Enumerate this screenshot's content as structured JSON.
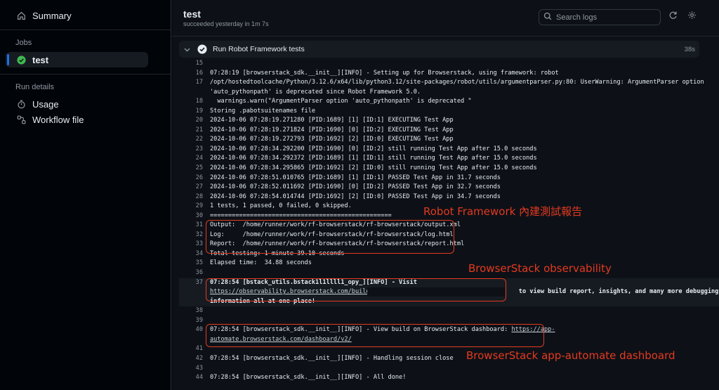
{
  "sidebar": {
    "summary": {
      "label": "Summary",
      "icon": "home-icon"
    },
    "jobs_heading": "Jobs",
    "jobs": [
      {
        "label": "test",
        "icon": "check-circle-icon"
      }
    ],
    "run_details_heading": "Run details",
    "details": [
      {
        "label": "Usage",
        "icon": "stopwatch-icon"
      },
      {
        "label": "Workflow file",
        "icon": "workflow-icon"
      }
    ]
  },
  "header": {
    "title": "test",
    "subtitle": "succeeded yesterday in 1m 7s",
    "search_placeholder": "Search logs"
  },
  "step": {
    "name": "Run Robot Framework tests",
    "duration": "38s"
  },
  "log_lines": [
    {
      "n": "15",
      "t": ""
    },
    {
      "n": "16",
      "t": "07:28:19 [browserstack_sdk.__init__][INFO] - Setting up for Browserstack, using framework: robot"
    },
    {
      "n": "17",
      "t": "/opt/hostedtoolcache/Python/3.12.6/x64/lib/python3.12/site-packages/robot/utils/argumentparser.py:80: UserWarning: ArgumentParser option"
    },
    {
      "n": "",
      "t": "'auto_pythonpath' is deprecated since Robot Framework 5.0."
    },
    {
      "n": "18",
      "t": "  warnings.warn(\"ArgumentParser option 'auto_pythonpath' is deprecated \""
    },
    {
      "n": "19",
      "t": "Storing .pabotsuitenames file"
    },
    {
      "n": "20",
      "t": "2024-10-06 07:28:19.271280 [PID:1689] [1] [ID:1] EXECUTING Test App"
    },
    {
      "n": "21",
      "t": "2024-10-06 07:28:19.271824 [PID:1690] [0] [ID:2] EXECUTING Test App"
    },
    {
      "n": "22",
      "t": "2024-10-06 07:28:19.272793 [PID:1692] [2] [ID:0] EXECUTING Test App"
    },
    {
      "n": "23",
      "t": "2024-10-06 07:28:34.292200 [PID:1690] [0] [ID:2] still running Test App after 15.0 seconds"
    },
    {
      "n": "24",
      "t": "2024-10-06 07:28:34.292372 [PID:1689] [1] [ID:1] still running Test App after 15.0 seconds"
    },
    {
      "n": "25",
      "t": "2024-10-06 07:28:34.295865 [PID:1692] [2] [ID:0] still running Test App after 15.0 seconds"
    },
    {
      "n": "26",
      "t": "2024-10-06 07:28:51.010765 [PID:1689] [1] [ID:1] PASSED Test App in 31.7 seconds"
    },
    {
      "n": "27",
      "t": "2024-10-06 07:28:52.011692 [PID:1690] [0] [ID:2] PASSED Test App in 32.7 seconds"
    },
    {
      "n": "28",
      "t": "2024-10-06 07:28:54.014744 [PID:1692] [2] [ID:0] PASSED Test App in 34.7 seconds"
    },
    {
      "n": "29",
      "t": "1 tests, 1 passed, 0 failed, 0 skipped."
    },
    {
      "n": "30",
      "t": "=================================================="
    },
    {
      "n": "31",
      "t": "Output:  /home/runner/work/rf-browserstack/rf-browserstack/output.xml"
    },
    {
      "n": "32",
      "t": "Log:     /home/runner/work/rf-browserstack/rf-browserstack/log.html"
    },
    {
      "n": "33",
      "t": "Report:  /home/runner/work/rf-browserstack/rf-browserstack/report.html"
    },
    {
      "n": "34",
      "t": "Total testing: 1 minute 39.10 seconds"
    },
    {
      "n": "35",
      "t": "Elapsed time:  34.88 seconds"
    },
    {
      "n": "36",
      "t": ""
    },
    {
      "n": "37",
      "t": "07:28:54 [bstack_utils.bstack1l1llll1_opy_][INFO] - Visit",
      "hl": true,
      "bold": true
    },
    {
      "n": "",
      "t": "https://observability.browserstack.com/builds.",
      "tail": "                                       to view build report, insights, and many more debugging",
      "hl": true,
      "link": true
    },
    {
      "n": "",
      "t": "information all at one place!",
      "hl": true,
      "bold": true
    },
    {
      "n": "38",
      "t": ""
    },
    {
      "n": "39",
      "t": ""
    },
    {
      "n": "40",
      "t": "07:28:54 [browserstack_sdk.__init__][INFO] - View build on BrowserStack dashboard: ",
      "tail": "https://app-",
      "tail_link": true
    },
    {
      "n": "",
      "t": "automate.browserstack.com/dashboard/v2/",
      "link": true
    },
    {
      "n": "41",
      "t": ""
    },
    {
      "n": "42",
      "t": "07:28:54 [browserstack_sdk.__init__][INFO] - Handling session close"
    },
    {
      "n": "43",
      "t": ""
    },
    {
      "n": "44",
      "t": "07:28:54 [browserstack_sdk.__init__][INFO] - All done!"
    }
  ],
  "annotations": {
    "robot": "Robot Framework 內建測試報告",
    "observability": "BrowserStack observability",
    "dashboard": "BrowserStack app-automate dashboard",
    "color": "#e5391f"
  },
  "colors": {
    "accent": "#1f6feb",
    "success": "#3fb950"
  }
}
